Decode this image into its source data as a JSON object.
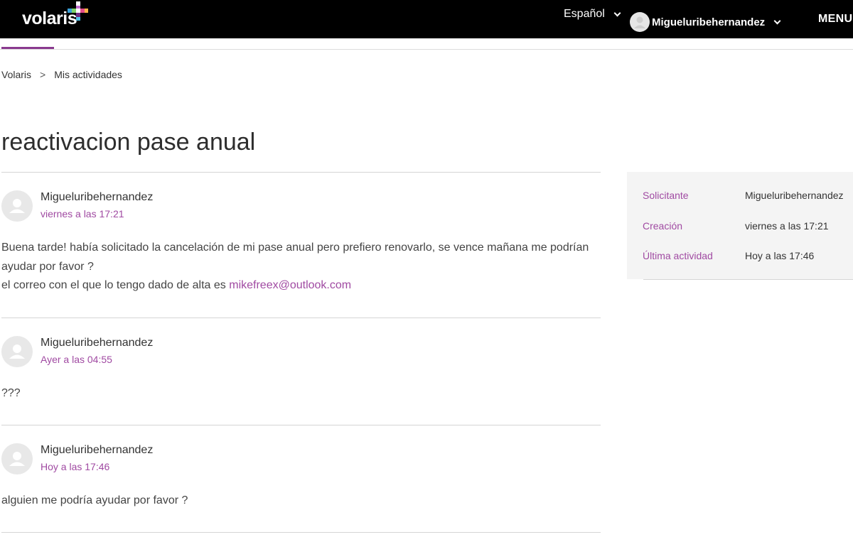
{
  "header": {
    "logo": "volaris",
    "language": "Español",
    "user": "Migueluribehernandez",
    "menu": "MENU"
  },
  "breadcrumb": {
    "home": "Volaris",
    "separator": ">",
    "current": "Mis actividades"
  },
  "request": {
    "title": "reactivacion pase anual"
  },
  "comments": [
    {
      "author": "Migueluribehernandez",
      "time": "viernes a las 17:21",
      "line1": "Buena tarde! había solicitado la cancelación de mi pase anual pero prefiero renovarlo, se vence mañana me podrían",
      "line2": "ayudar por favor ?",
      "line3": "el correo con el que lo tengo dado de alta es",
      "email": "mikefreex@outlook.com"
    },
    {
      "author": "Migueluribehernandez",
      "time": "Ayer a las 04:55",
      "line1": "???"
    },
    {
      "author": "Migueluribehernandez",
      "time": "Hoy a las 17:46",
      "line1": "alguien me podría ayudar por favor ?"
    }
  ],
  "details": {
    "requester_label": "Solicitante",
    "requester_value": "Migueluribehernandez",
    "created_label": "Creación",
    "created_value": "viernes a las 17:21",
    "last_activity_label": "Última actividad",
    "last_activity_value": "Hoy a las 17:46"
  },
  "colors": {
    "accent": "#a04aa2",
    "header_bg": "#000000",
    "sidebar_bg": "#f4f4f4"
  },
  "icons": [
    "volaris-plus-logo-icon",
    "chevron-down-icon",
    "user-avatar-icon"
  ]
}
